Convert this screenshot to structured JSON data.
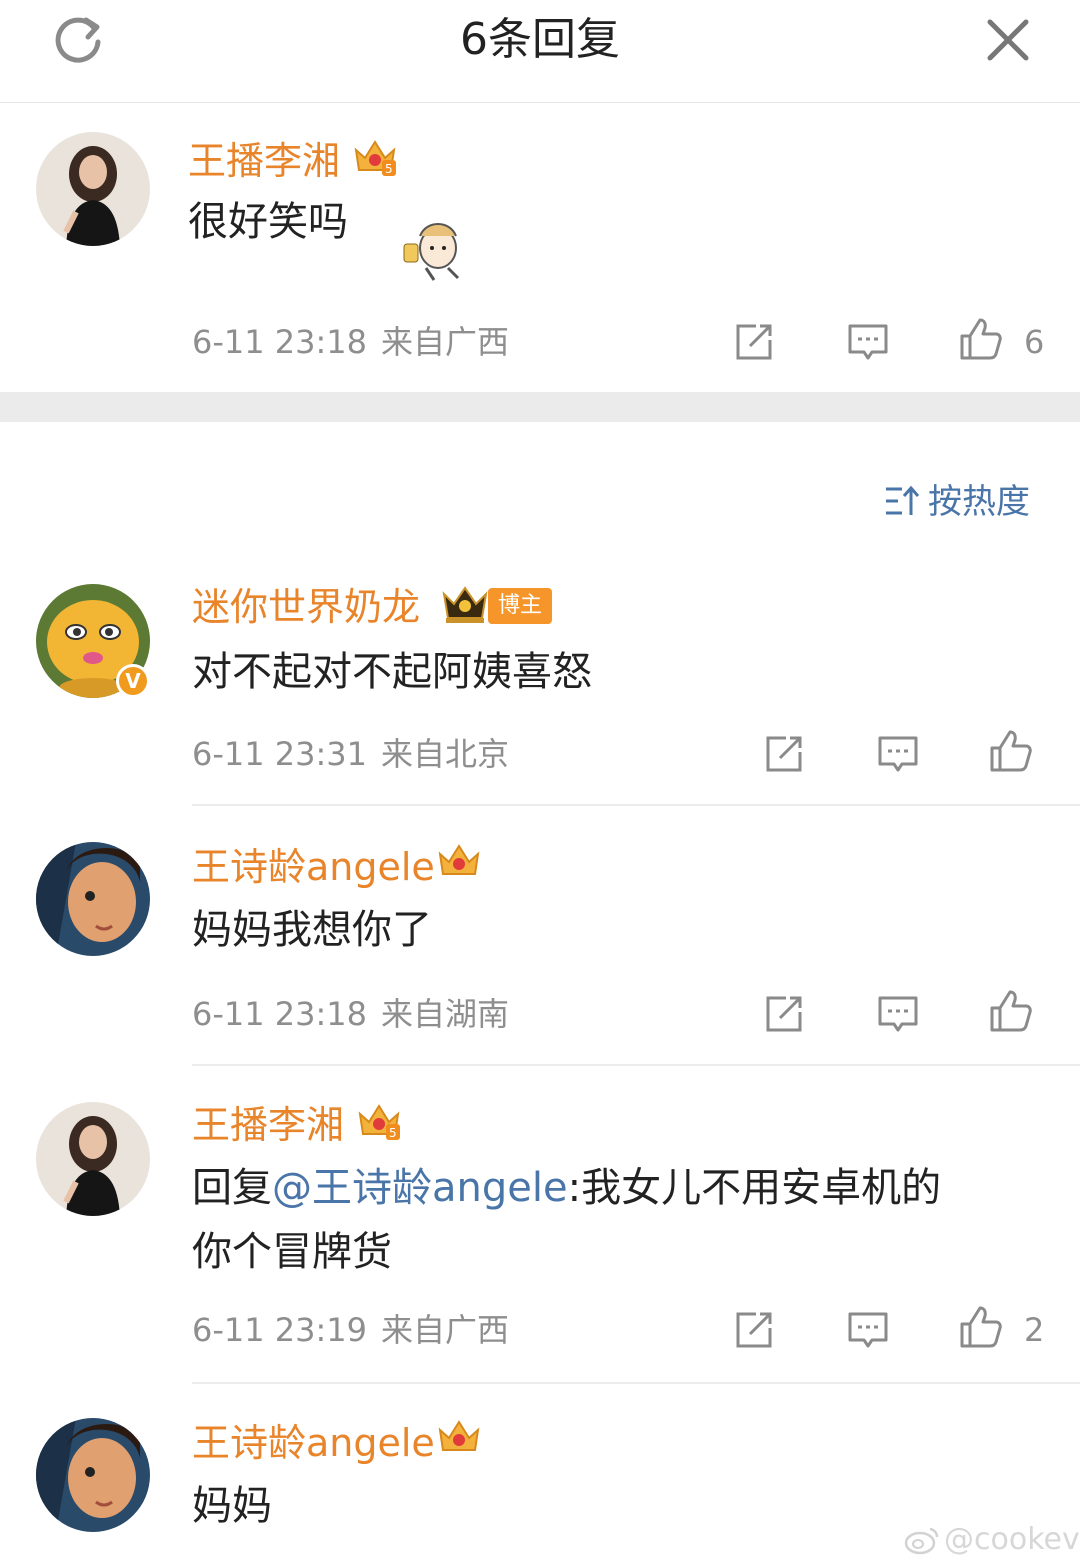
{
  "header": {
    "title": "6条回复",
    "refresh_icon": "refresh-icon",
    "close_icon": "close-icon"
  },
  "root_comment": {
    "author": "王播李湘",
    "level_badge": "5",
    "text": "很好笑吗",
    "time": "6-11 23:18",
    "location": "来自广西",
    "likes": "6"
  },
  "sort": {
    "label": "按热度",
    "icon": "sort-icon"
  },
  "replies": [
    {
      "author": "迷你世界奶龙",
      "tag": "博主",
      "verified": "V",
      "text": "对不起对不起阿姨喜怒",
      "time": "6-11 23:31",
      "location": "来自北京",
      "likes": ""
    },
    {
      "author": "王诗龄angele",
      "text": "妈妈我想你了",
      "time": "6-11 23:18",
      "location": "来自湖南",
      "likes": ""
    },
    {
      "author": "王播李湘",
      "level_badge": "5",
      "text_prefix": "回复",
      "mention": "@王诗龄angele",
      "text_line1_rest": ":我女儿不用安卓机的",
      "text_line2": "你个冒牌货",
      "time": "6-11 23:19",
      "location": "来自广西",
      "likes": "2"
    },
    {
      "author": "王诗龄angele",
      "text": "妈妈",
      "time": "",
      "location": "",
      "likes": ""
    }
  ],
  "watermark": "@cookev",
  "colors": {
    "name": "#e8842a",
    "link": "#4a75a8",
    "meta": "#8e8e8e",
    "tag": "#f5952a"
  }
}
